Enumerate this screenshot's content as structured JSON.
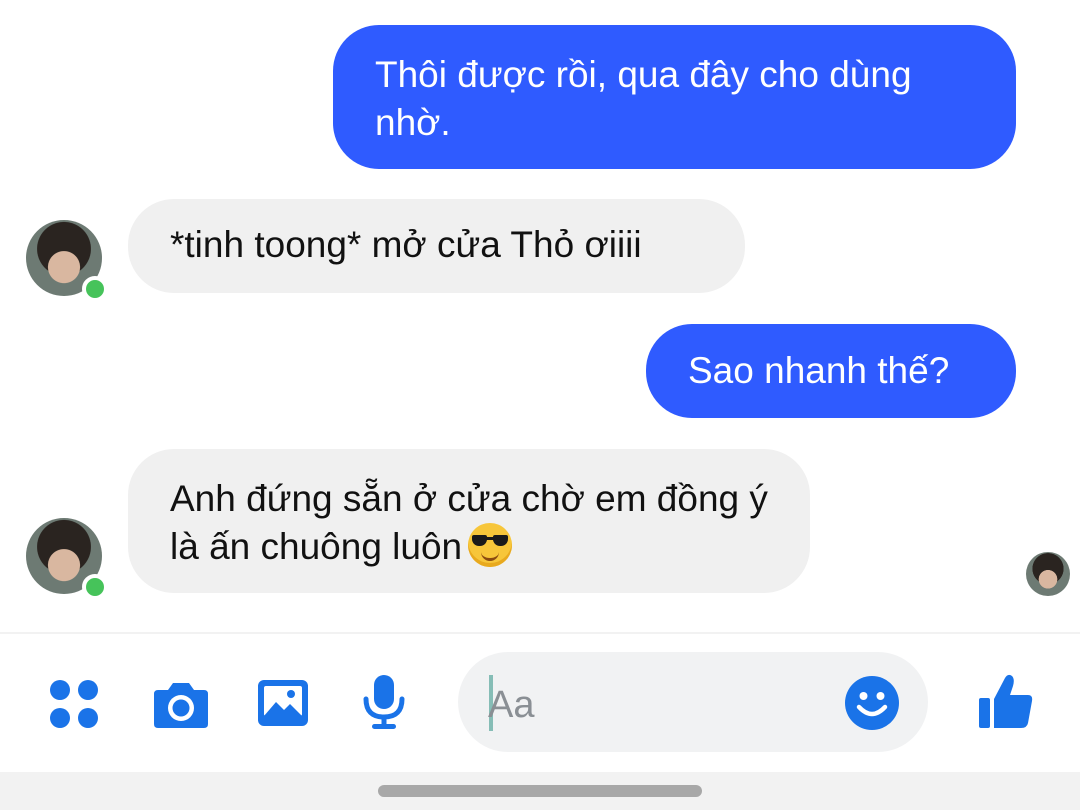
{
  "messages": [
    {
      "side": "outgoing",
      "text": "Thôi được rồi, qua đây cho dùng nhờ."
    },
    {
      "side": "incoming",
      "text": "*tinh toong* mở cửa Thỏ ơiiii"
    },
    {
      "side": "outgoing",
      "text": "Sao nhanh thế?"
    },
    {
      "side": "incoming",
      "text": "Anh đứng sẵn ở cửa chờ em đồng ý là ấn chuông luôn",
      "emoji": "smiling-face-with-sunglasses"
    }
  ],
  "composer": {
    "placeholder": "Aa"
  },
  "toolbar": {
    "icons": [
      "apps-icon",
      "camera-icon",
      "image-icon",
      "microphone-icon",
      "emoji-icon",
      "thumbs-up-icon"
    ]
  },
  "colors": {
    "accent": "#1a73e8",
    "outgoing_bubble": "#2f5bff",
    "incoming_bubble": "#f0f0f0",
    "online": "#46c35a"
  }
}
